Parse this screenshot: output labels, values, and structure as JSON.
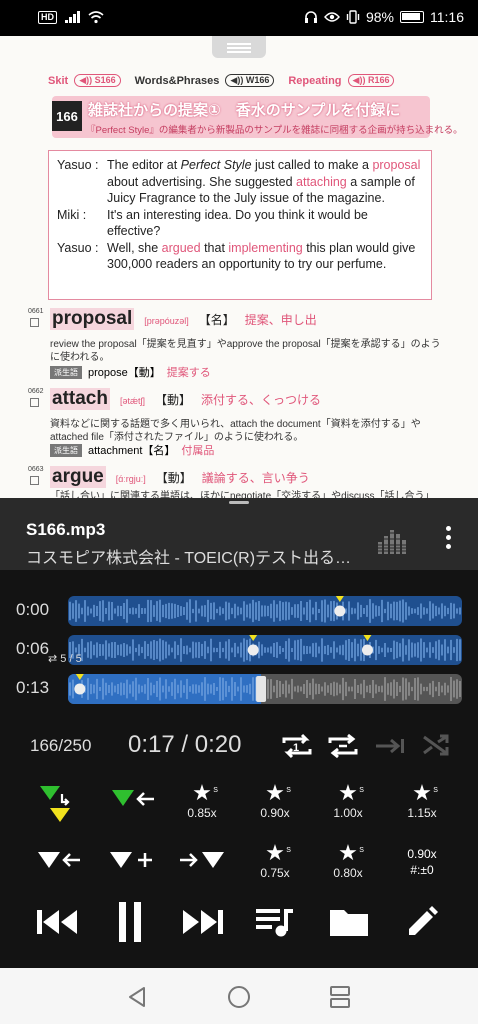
{
  "status": {
    "hd": "HD",
    "battery": "98%",
    "time": "11:16"
  },
  "document": {
    "tags": {
      "skit": "Skit",
      "skit_chip": "◀)) S166",
      "phrases": "Words&Phrases",
      "phrases_chip": "◀)) W166",
      "repeating": "Repeating",
      "repeating_chip": "◀)) R166"
    },
    "unit_number": "166",
    "unit_title": "雑誌社からの提案①　香水のサンプルを付録に",
    "unit_subtitle": "『Perfect Style』の編集者から新製品のサンプルを雑誌に同梱する企画が持ち込まれる。",
    "dialog": [
      {
        "speaker": "Yasuo :",
        "parts": [
          "The editor at ",
          "Perfect Style",
          " just called to make a ",
          "proposal",
          " about advertising. She suggested ",
          "attaching",
          " a sample of Juicy Fragrance to the July issue of the magazine."
        ]
      },
      {
        "speaker": "Miki :",
        "parts": [
          "It's an interesting idea. Do you think it would be effective?"
        ]
      },
      {
        "speaker": "Yasuo :",
        "parts": [
          "Well, she ",
          "argued",
          " that ",
          "implementing",
          " this plan would give 300,000 readers an opportunity to try our perfume."
        ]
      }
    ],
    "entries": [
      {
        "index": "0661",
        "word": "proposal",
        "pron": "[prəpóuzəl]",
        "pos": "【名】",
        "meaning": "提案、申し出",
        "desc": "review the proposal「提案を見直す」やapprove the proposal「提案を承認する」のように使われる。",
        "deriv_tag": "派生語",
        "deriv": "propose【動】",
        "deriv_meaning": "提案する"
      },
      {
        "index": "0662",
        "word": "attach",
        "pron": "[ətǽtʃ]",
        "pos": "【動】",
        "meaning": "添付する、くっつける",
        "desc": "資料などに関する話題で多く用いられ、attach the document「資料を添付する」やattached file「添付されたファイル」のように使われる。",
        "deriv_tag": "派生語",
        "deriv": "attachment【名】",
        "deriv_meaning": "付属品"
      },
      {
        "index": "0663",
        "word": "argue",
        "pron": "[ɑ́ːrgjuː]",
        "pos": "【動】",
        "meaning": "議論する、言い争う",
        "desc": "「話し合い」に関連する単語は、ほかにnegotiate「交渉する」やdiscuss「話し合う」"
      }
    ]
  },
  "player": {
    "file_name": "S166.mp3",
    "subtitle": "コスモピア株式会社 - TOEIC(R)テスト出る…",
    "wave_rows": [
      {
        "time": "0:00",
        "markers": [
          0.69
        ]
      },
      {
        "time": "0:06",
        "markers": [
          0.47,
          0.76
        ]
      },
      {
        "time": "0:13",
        "markers": [
          0.03
        ],
        "progress": 0.49
      }
    ],
    "loop_info": "5 / 5",
    "track_count": "166/250",
    "time_display": "0:17 / 0:20",
    "speed_buttons": [
      {
        "label": "0.85x"
      },
      {
        "label": "0.90x"
      },
      {
        "label": "1.00x"
      },
      {
        "label": "1.15x"
      },
      {
        "label": "0.75x"
      },
      {
        "label": "0.80x"
      }
    ],
    "speed_status_1": "0.90x",
    "speed_status_2": "#:±0",
    "colors": {
      "accent_blue": "#2f6fc2",
      "marker_yellow": "#f2e21e",
      "marker_green": "#2fbf2f",
      "pink": "#e0567a"
    }
  }
}
